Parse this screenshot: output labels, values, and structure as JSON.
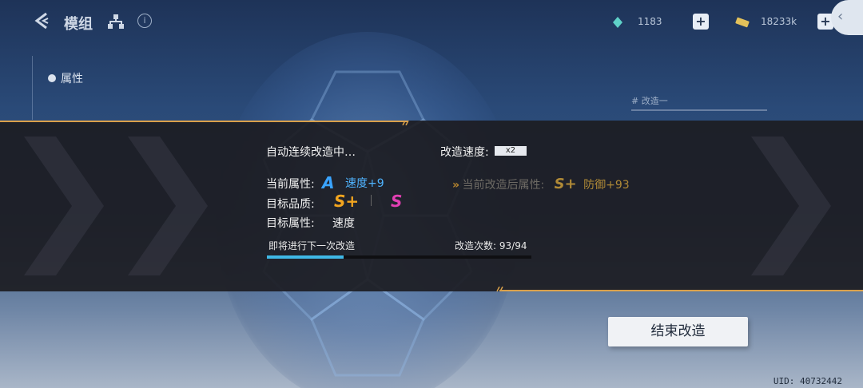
{
  "header": {
    "title": "模组",
    "resources": [
      {
        "icon": "energy-crystal-icon",
        "value": "1183"
      },
      {
        "icon": "gold-ticket-icon",
        "value": "18233k"
      }
    ]
  },
  "sidebar": {
    "tab_label": "属性"
  },
  "side_panel": {
    "remodel_label": "# 改造一"
  },
  "panel": {
    "status": "自动连续改造中…",
    "speed_label": "改造速度:",
    "speed_value": "x2",
    "current_attr_label": "当前属性:",
    "current_grade": "A",
    "current_attr_value": "速度+9",
    "after_label": "当前改造后属性:",
    "after_grade": "S+",
    "after_value": "防御+93",
    "target_quality_label": "目标品质:",
    "target_grades": [
      "S+",
      "S"
    ],
    "target_attr_label": "目标属性:",
    "target_attr_value": "速度",
    "next_label": "即将进行下一次改造",
    "count_label": "改造次数:",
    "count_value": "93/94",
    "progress": 0.29
  },
  "actions": {
    "end_label": "结束改造"
  },
  "footer": {
    "uid": "UID: 40732442"
  },
  "colors": {
    "accent_line": "#d9a04a",
    "grade_a": "#3aa4ff",
    "grade_s_plus": "#f2a51f",
    "grade_s": "#e23fb3",
    "progress": "#3fb8e6"
  }
}
